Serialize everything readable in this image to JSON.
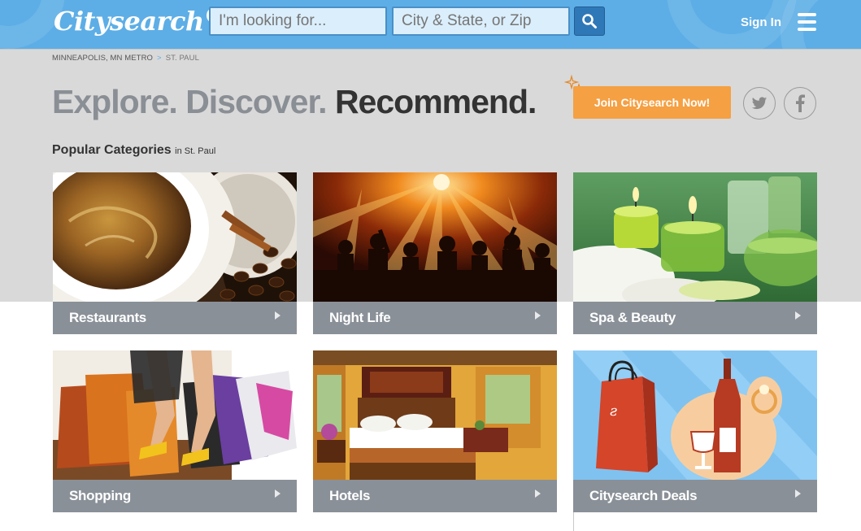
{
  "header": {
    "logo_text": "Citysearch",
    "search_what_placeholder": "I'm looking for...",
    "search_where_placeholder": "City & State, or Zip",
    "search_button_icon": "search-icon",
    "signin_label": "Sign In",
    "menu_icon": "hamburger-menu-icon"
  },
  "breadcrumb": {
    "metro": "MINNEAPOLIS, MN METRO",
    "separator": ">",
    "current": "ST. PAUL"
  },
  "hero": {
    "tagline_1": "Explore.",
    "tagline_2": "Discover.",
    "tagline_3": "Recommend.",
    "join_label": "Join Citysearch Now!"
  },
  "social": {
    "twitter_icon": "twitter-icon",
    "facebook_icon": "facebook-icon"
  },
  "categories": {
    "heading": "Popular Categories",
    "location": "in St. Paul",
    "items": [
      {
        "label": "Restaurants"
      },
      {
        "label": "Night Life"
      },
      {
        "label": "Spa & Beauty"
      },
      {
        "label": "Shopping"
      },
      {
        "label": "Hotels"
      },
      {
        "label": "Citysearch Deals"
      }
    ]
  },
  "colors": {
    "header_blue": "#5daee6",
    "search_button": "#2f78b8",
    "join_orange": "#f5a043",
    "tile_bar": "#8a9098",
    "band_grey": "#d9d9d9"
  }
}
